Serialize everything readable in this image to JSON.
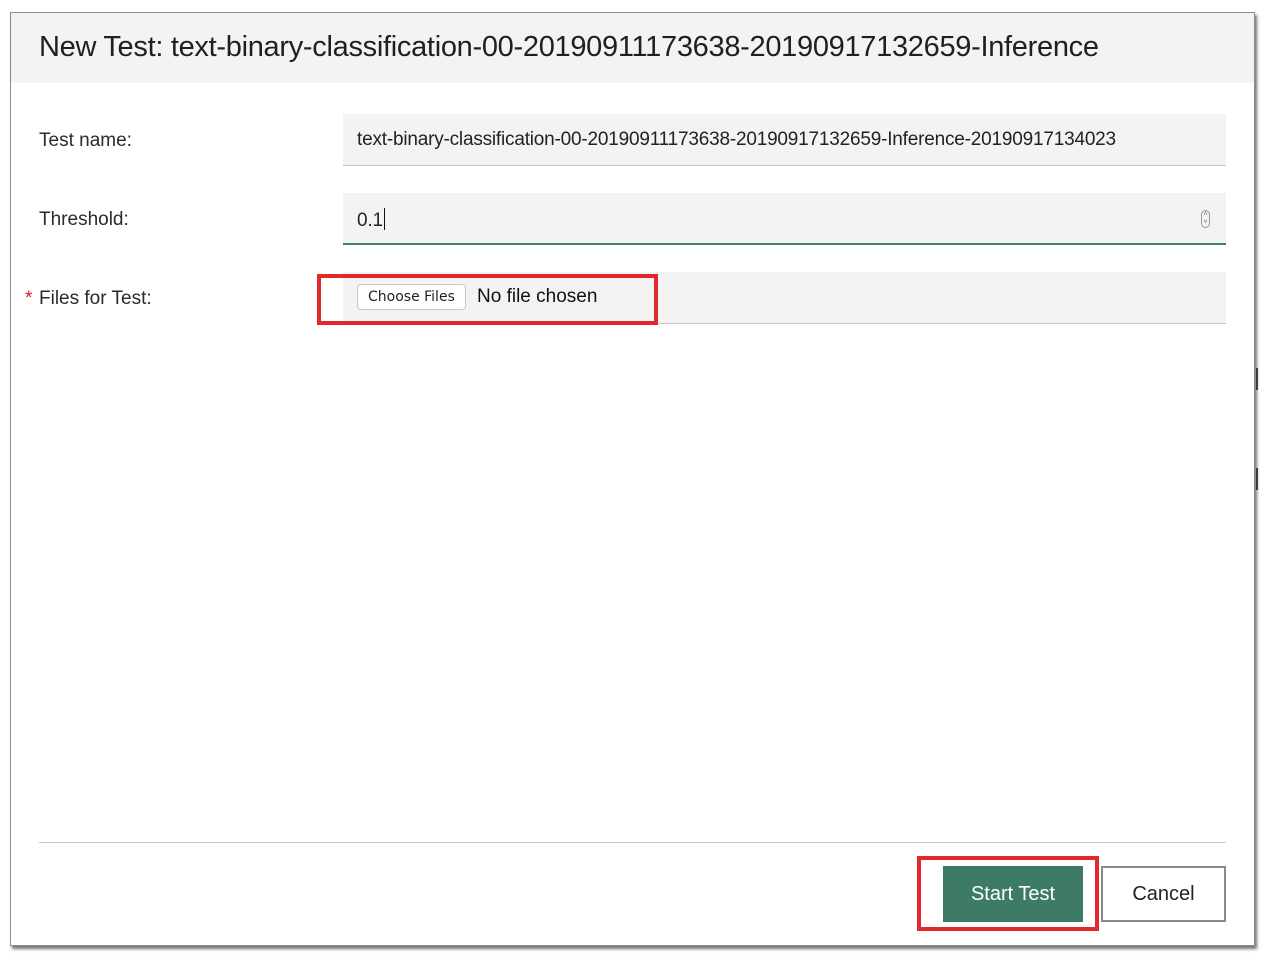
{
  "dialog": {
    "title": "New Test: text-binary-classification-00-20190911173638-20190917132659-Inference"
  },
  "form": {
    "test_name": {
      "label": "Test name:",
      "value": "text-binary-classification-00-20190911173638-20190917132659-Inference-20190917134023"
    },
    "threshold": {
      "label": "Threshold:",
      "value": "0.1"
    },
    "files": {
      "required_marker": "*",
      "label": "Files for Test:",
      "button_label": "Choose Files",
      "status": "No file chosen"
    }
  },
  "footer": {
    "start_label": "Start Test",
    "cancel_label": "Cancel"
  },
  "colors": {
    "primary": "#3d7a67",
    "highlight": "#e0282d",
    "required": "#da1e28"
  }
}
